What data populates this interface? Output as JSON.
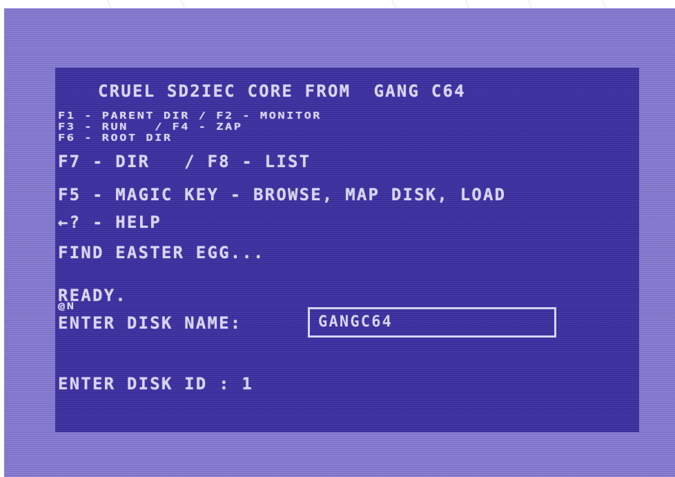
{
  "screen": {
    "title": "CRUEL SD2IEC CORE FROM  GANG C64",
    "keys": {
      "line1": "F1 - PARENT DIR / F2 - MONITOR",
      "line2": "F3 - RUN   / F4 - ZAP",
      "line3": "F6 - ROOT DIR",
      "line4": "F7 - DIR   / F8 - LIST"
    },
    "magic_key": "F5 - MAGIC KEY - BROWSE, MAP DISK, LOAD",
    "help": "←? - HELP",
    "easter_egg": "FIND EASTER EGG...",
    "ready": "READY.",
    "command": "@N",
    "disk_name_prompt": "ENTER DISK NAME:",
    "disk_name_value": "GANGC64",
    "disk_id_prompt": "ENTER DISK ID : 1"
  },
  "colors": {
    "border": "#8379d3",
    "background": "#3d31a3",
    "text": "#d8d4f4"
  }
}
